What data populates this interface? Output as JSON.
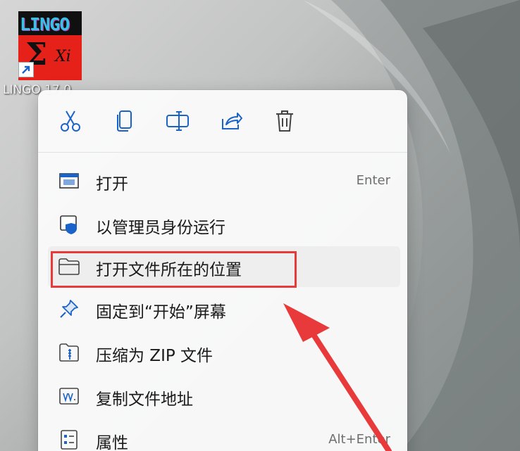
{
  "desktop_icon": {
    "logo_text": "LINGO",
    "logo_symbol_sigma": "Σ",
    "logo_symbol_xi": "Xi",
    "label": "LINGO 17.0"
  },
  "context_menu": {
    "actions": [
      {
        "name": "cut",
        "icon": "scissors-icon"
      },
      {
        "name": "copy",
        "icon": "copy-icon"
      },
      {
        "name": "rename",
        "icon": "rename-icon"
      },
      {
        "name": "share",
        "icon": "share-icon"
      },
      {
        "name": "delete",
        "icon": "trash-icon"
      }
    ],
    "items": [
      {
        "label": "打开",
        "shortcut": "Enter",
        "icon": "open-app-icon"
      },
      {
        "label": "以管理员身份运行",
        "shortcut": "",
        "icon": "shield-icon"
      },
      {
        "label": "打开文件所在的位置",
        "shortcut": "",
        "icon": "folder-icon"
      },
      {
        "label": "固定到“开始”屏幕",
        "shortcut": "",
        "icon": "pin-icon"
      },
      {
        "label": "压缩为 ZIP 文件",
        "shortcut": "",
        "icon": "zip-folder-icon"
      },
      {
        "label": "复制文件地址",
        "shortcut": "",
        "icon": "copy-path-icon"
      },
      {
        "label": "属性",
        "shortcut": "Alt+Enter",
        "icon": "properties-icon"
      }
    ],
    "highlighted_item_index": 2
  },
  "colors": {
    "accent_icon": "#1a63c9",
    "annotation_red": "#e83a3a",
    "menu_background": "#fafafa",
    "hover_background": "#eeeeee"
  }
}
